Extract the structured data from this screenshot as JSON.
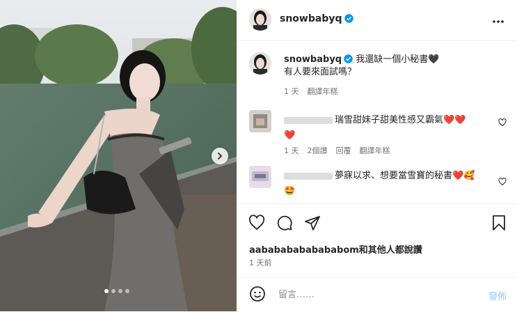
{
  "post": {
    "username": "snowbabyq",
    "verified": true,
    "caption_line1": "我還缺一個小秘書🖤",
    "caption_line2": "有人要來面試嗎？",
    "caption_age": "1 天",
    "translate_label": "翻譯年糕"
  },
  "media": {
    "slide_count": 4,
    "active_slide": 1
  },
  "comments": [
    {
      "text": "瑞雪甜妹子甜美性感又霸氣❤️❤️",
      "text2": "❤️",
      "age": "1 天",
      "likes": "2個讚",
      "reply": "回覆",
      "translate": "翻譯年糕"
    },
    {
      "text": "夢寐以求、想要當雪寶的秘書❤️🥰",
      "text2": "🤩"
    }
  ],
  "stats": {
    "likes_text": "aabababababababom和其他人都說讚",
    "posted": "1 天前"
  },
  "composer": {
    "placeholder": "留言……",
    "post_label": "發佈"
  },
  "icons": [
    "more-icon",
    "heart-icon",
    "comment-icon",
    "share-icon",
    "bookmark-icon",
    "emoji-icon",
    "chevron-right-icon",
    "verified-icon"
  ],
  "colors": {
    "accent": "#0095f6",
    "post_disabled": "#b3dbff",
    "heart": "#ed4956"
  }
}
